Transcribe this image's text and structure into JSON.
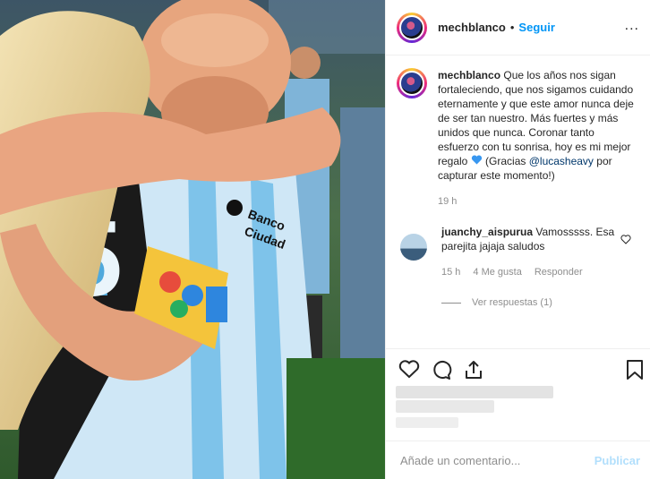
{
  "post": {
    "photo_alt": "photo",
    "jersey_text_1": "Banco",
    "jersey_text_2": "Ciudad"
  },
  "header": {
    "username": "mechblanco",
    "separator": "•",
    "follow_label": "Seguir",
    "more_label": "..."
  },
  "caption": {
    "username": "mechblanco",
    "text_1": "Que los años nos sigan fortaleciendo, que nos sigamos cuidando eternamente y que este amor nunca deje de ser tan nuestro. Más fuertes y más unidos que nunca. Coronar tanto esfuerzo con tu sonrisa, hoy es mi mejor regalo ",
    "text_2": " (Gracias ",
    "mention": "@lucasheavy",
    "text_3": " por capturar este momento!)",
    "time": "19 h"
  },
  "comment": {
    "username": "juanchy_aispurua",
    "text": "Vamosssss. Esa parejita jajaja saludos",
    "time": "15 h",
    "likes": "4 Me gusta",
    "reply": "Responder",
    "view_replies": "Ver respuestas (1)"
  },
  "composer": {
    "placeholder": "Añade un comentario...",
    "publish": "Publicar"
  },
  "colors": {
    "link": "#0095f6",
    "muted": "#8e8e8e",
    "heart": "#3897f0"
  }
}
